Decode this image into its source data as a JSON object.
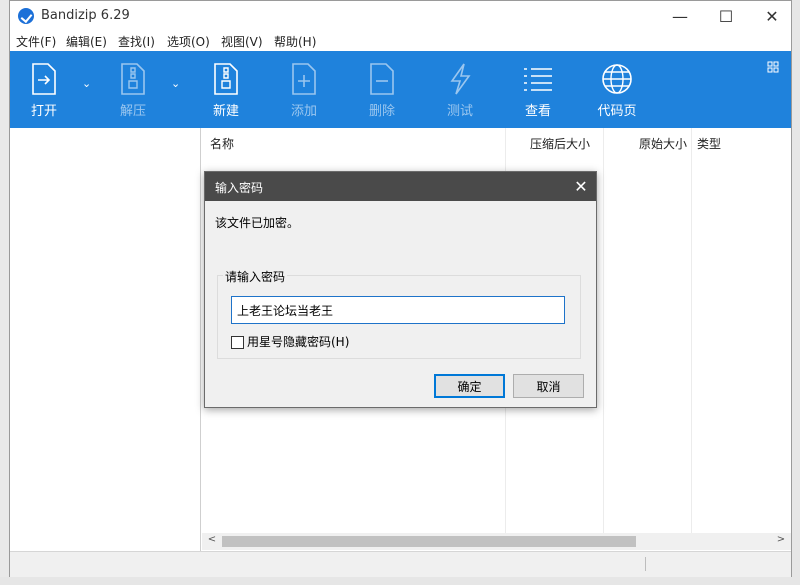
{
  "window": {
    "title": "Bandizip 6.29",
    "minimize": "—",
    "maximize": "☐",
    "close": "✕"
  },
  "menu": [
    "文件(F)",
    "编辑(E)",
    "查找(I)",
    "选项(O)",
    "视图(V)",
    "帮助(H)"
  ],
  "toolbar": {
    "open": "打开",
    "extract": "解压",
    "new": "新建",
    "add": "添加",
    "delete": "删除",
    "test": "测试",
    "view": "查看",
    "codepage": "代码页",
    "dropdown_arrow": "⌄"
  },
  "columns": {
    "name": "名称",
    "compressed": "压缩后大小",
    "original": "原始大小",
    "type": "类型"
  },
  "scroll": {
    "left": "<",
    "right": ">"
  },
  "dialog": {
    "title": "输入密码",
    "close": "✕",
    "message": "该文件已加密。",
    "group_label": "请输入密码",
    "password_value": "上老王论坛当老王",
    "hide_label": "用星号隐藏密码(H)",
    "hide_checked": false,
    "ok": "确定",
    "cancel": "取消"
  },
  "colors": {
    "toolbar": "#1f82dc",
    "dialog_title": "#4a4a4a",
    "accent": "#0078d7"
  }
}
